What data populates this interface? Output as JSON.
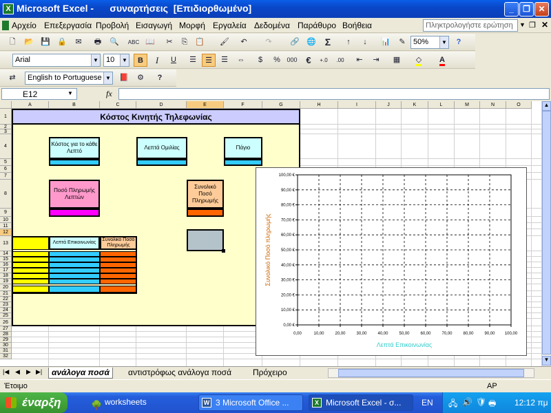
{
  "window": {
    "app": "Microsoft Excel -",
    "doc": "συναρτήσεις  [Επιδιορθωμένο]",
    "controls": {
      "minimize": "_",
      "restore": "❐",
      "close": "✕"
    }
  },
  "menu": {
    "items": [
      "Αρχείο",
      "Επεξεργασία",
      "Προβολή",
      "Εισαγωγή",
      "Μορφή",
      "Εργαλεία",
      "Δεδομένα",
      "Παράθυρο",
      "Βοήθεια"
    ],
    "ask_placeholder": "Πληκτρολογήστε ερώτηση"
  },
  "toolbar": {
    "zoom": "50%",
    "font": "Arial",
    "size": "10",
    "bold": "B",
    "italic": "I",
    "underline": "U",
    "percent": "%",
    "thousands": "000",
    "euro": "€",
    "translate": "English to Portuguese"
  },
  "formula_bar": {
    "name_box": "E12",
    "fx": "fx",
    "content": ""
  },
  "sheet": {
    "columns": [
      "A",
      "B",
      "C",
      "D",
      "E",
      "F",
      "G",
      "H",
      "I",
      "J",
      "K",
      "L",
      "M",
      "N",
      "O"
    ],
    "selected_column": "E",
    "selected_row": "12",
    "rows": [
      "1",
      "2",
      "3",
      "4",
      "5",
      "6",
      "7",
      "8",
      "9",
      "10",
      "11",
      "12",
      "13",
      "14",
      "15",
      "16",
      "17",
      "18",
      "19",
      "20",
      "21",
      "22",
      "23",
      "24",
      "25",
      "26",
      "27",
      "28",
      "29",
      "30",
      "31",
      "32"
    ],
    "title": "Κόστος Κινητής Τηλεφωνίας",
    "labels": {
      "cost_per_minute": "Κόστος για το κάθε Λεπτό",
      "talk_minutes": "Λεπτά Ομιλίας",
      "fixed_fee": "Πάγιο",
      "rate_per_minute": "Ποσό Πληρωμής Λεπτών",
      "total_payment": "Συνολικό Ποσό Πληρωμής",
      "col_minutes": "Λεπτά Επικοινωνίας",
      "col_total": "Συνολικό Ποσό Πληρωμής"
    },
    "colors": {
      "panel": "#ffffcc",
      "header": "#ccccff",
      "light_blue": "#ccffff",
      "cyan": "#33ccff",
      "pink": "#ff99cc",
      "magenta": "#ff00ff",
      "peach": "#ffcc99",
      "orange": "#ff6600",
      "yellow": "#ffff00",
      "selection": "#b4c2c9"
    }
  },
  "chart_data": {
    "type": "scatter",
    "title": "",
    "xlabel": "Λεπτά Επικοινωνίας",
    "ylabel": "Συνολικό Ποσό πληρωμής",
    "xlim": [
      0,
      100
    ],
    "ylim": [
      0,
      100
    ],
    "x_ticks": [
      "0,00",
      "10,00",
      "20,00",
      "30,00",
      "40,00",
      "50,00",
      "60,00",
      "70,00",
      "80,00",
      "90,00",
      "100,00"
    ],
    "y_ticks": [
      "0,00 €",
      "10,00 €",
      "20,00 €",
      "30,00 €",
      "40,00 €",
      "50,00 €",
      "60,00 €",
      "70,00 €",
      "80,00 €",
      "90,00 €",
      "100,00 €"
    ],
    "series": [],
    "grid": true,
    "xlabel_color": "#33cccc",
    "ylabel_color": "#cc6600"
  },
  "sheet_tabs": {
    "tabs": [
      "ανάλογα ποσά",
      "αντιστρόφως ανάλογα ποσά",
      "Πρόχειρο"
    ],
    "active": "ανάλογα ποσά"
  },
  "status": {
    "left": "Έτοιμο",
    "right": "AP"
  },
  "taskbar": {
    "start": "έναρξη",
    "tasks": [
      {
        "label": "worksheets"
      },
      {
        "label": "3 Microsoft Office ..."
      },
      {
        "label": "Microsoft Excel - σ..."
      }
    ],
    "lang": "EN",
    "clock": "12:12 πμ"
  }
}
